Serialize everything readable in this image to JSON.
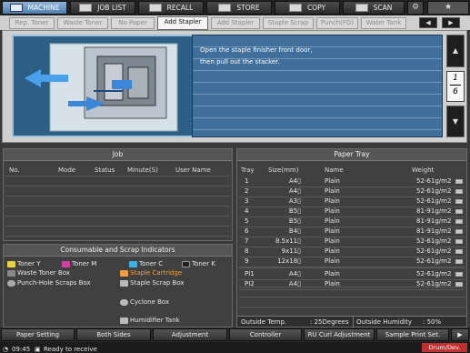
{
  "modes": [
    {
      "label": "MACHINE",
      "active": true
    },
    {
      "label": "JOB LIST",
      "active": false
    },
    {
      "label": "RECALL",
      "active": false
    },
    {
      "label": "STORE",
      "active": false
    },
    {
      "label": "COPY",
      "active": false
    },
    {
      "label": "SCAN",
      "active": false
    }
  ],
  "tabs": [
    "Rep. Toner",
    "Waste Toner",
    "No Paper",
    "Add Stapler",
    "Add Stapler",
    "Staple Scrap",
    "Punch(FD)",
    "Water Tank"
  ],
  "tab_nav": {
    "prev": "◀",
    "next": "▶"
  },
  "message": {
    "line1": "Open the staple finisher front door,",
    "line2": "then pull out the stacker."
  },
  "page": {
    "up": "▲",
    "down": "▼",
    "current": "1",
    "total": "6"
  },
  "job": {
    "title": "Job",
    "headers": [
      "No.",
      "Mode",
      "Status",
      "Minute(S)",
      "User Name"
    ]
  },
  "consumables": {
    "title": "Consumable and Scrap Indicators",
    "items": [
      "Toner Y",
      "Toner M",
      "Toner C",
      "Toner K",
      "Waste Toner Box",
      "Staple Cartridge",
      "Punch-Hole Scraps Box",
      "Staple Scrap Box",
      "Cyclone Box",
      "Humidifier Tank"
    ]
  },
  "paper_tray": {
    "title": "Paper Tray",
    "headers": [
      "Tray",
      "Size(mm)",
      "Name",
      "Weight"
    ],
    "rows": [
      {
        "tray": "1",
        "size": "A4▯",
        "name": "Plain",
        "weight": "52-61g/m2"
      },
      {
        "tray": "2",
        "size": "A4▯",
        "name": "Plain",
        "weight": "52-61g/m2"
      },
      {
        "tray": "3",
        "size": "A3▯",
        "name": "Plain",
        "weight": "52-61g/m2"
      },
      {
        "tray": "4",
        "size": "B5▯",
        "name": "Plain",
        "weight": "81-91g/m2"
      },
      {
        "tray": "5",
        "size": "B5▯",
        "name": "Plain",
        "weight": "81-91g/m2"
      },
      {
        "tray": "6",
        "size": "B4▯",
        "name": "Plain",
        "weight": "81-91g/m2"
      },
      {
        "tray": "7",
        "size": "8.5x11▯",
        "name": "Plain",
        "weight": "52-61g/m2"
      },
      {
        "tray": "8",
        "size": "9x11▯",
        "name": "Plain",
        "weight": "52-61g/m2"
      },
      {
        "tray": "9",
        "size": "12x18▯",
        "name": "Plain",
        "weight": "52-61g/m2"
      },
      {
        "tray": "PI1",
        "size": "A4▯",
        "name": "Plain",
        "weight": "52-61g/m2"
      },
      {
        "tray": "PI2",
        "size": "A4▯",
        "name": "Plain",
        "weight": "52-61g/m2"
      }
    ],
    "outside_temp_label": "Outside Temp.",
    "outside_temp_value": ": 25Degrees",
    "outside_humidity_label": "Outside Humidity",
    "outside_humidity_value": ": 50%"
  },
  "bottom_buttons": [
    "Paper Setting",
    "Both Sides",
    "Adjustment",
    "Controller",
    "RU Curl Adjustment",
    "Sample Print Set."
  ],
  "status": {
    "time": "09:45",
    "text": "Ready to receive",
    "badge": "Drum/Dev."
  },
  "colors": {
    "accent": "#4f7fae",
    "warning": "#f0a040",
    "panel": "#404040"
  }
}
